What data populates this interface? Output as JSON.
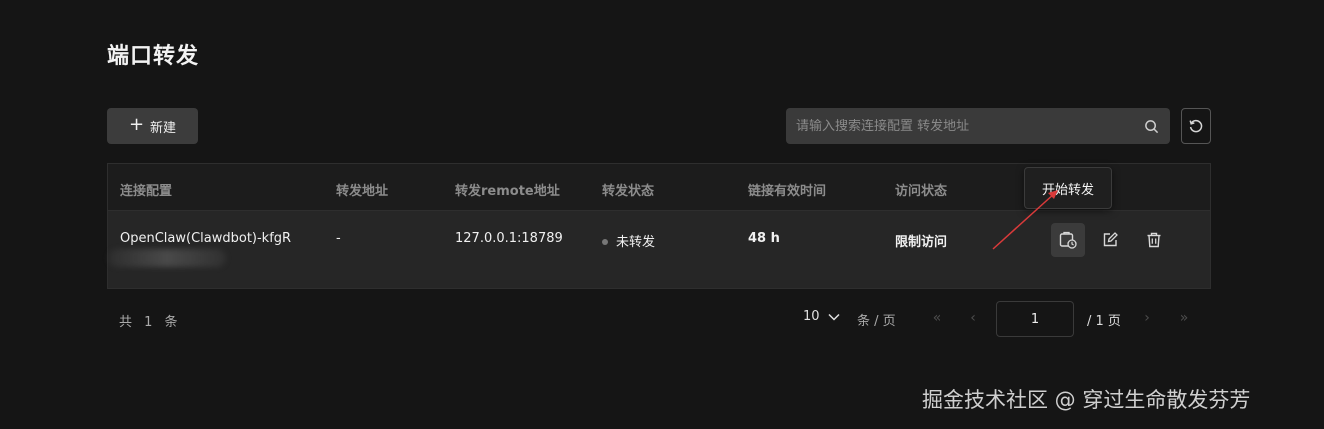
{
  "header": {
    "title": "端口转发"
  },
  "toolbar": {
    "new_label": "新建",
    "search_placeholder": "请输入搜索连接配置 转发地址"
  },
  "table": {
    "columns": [
      "连接配置",
      "转发地址",
      "转发remote地址",
      "转发状态",
      "链接有效时间",
      "访问状态"
    ],
    "rows": [
      {
        "config": "OpenClaw(Clawdbot)-kfgR",
        "forward_address": "-",
        "remote_address": "127.0.0.1:18789",
        "status": "未转发",
        "valid_time": "48 h",
        "access_status": "限制访问"
      }
    ]
  },
  "tooltip": {
    "text": "开始转发"
  },
  "pagination": {
    "total_text": "共 1 条",
    "page_size": "10",
    "page_size_suffix": "条 / 页",
    "current_page": "1",
    "total_pages_text": "/ 1 页"
  },
  "watermark": "掘金技术社区 @ 穿过生命散发芬芳",
  "colors": {
    "background": "#151515",
    "annotation_arrow": "#d93a3a"
  }
}
